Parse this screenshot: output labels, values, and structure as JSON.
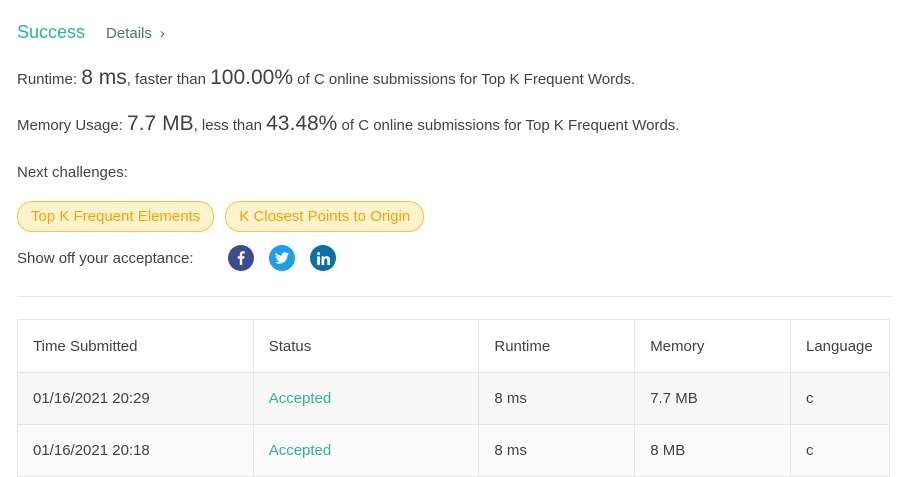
{
  "header": {
    "status": "Success",
    "details_label": "Details",
    "chevron": "›"
  },
  "runtime": {
    "label": "Runtime: ",
    "value": "8 ms",
    "mid": ", faster than ",
    "percent": "100.00%",
    "tail": " of C online submissions for Top K Frequent Words."
  },
  "memory": {
    "label": "Memory Usage: ",
    "value": "7.7 MB",
    "mid": ", less than ",
    "percent": "43.48%",
    "tail": " of C online submissions for Top K Frequent Words."
  },
  "next": {
    "label": "Next challenges:",
    "challenges": [
      "Top K Frequent Elements",
      "K Closest Points to Origin"
    ]
  },
  "share": {
    "label": "Show off your acceptance:",
    "icons": [
      "facebook-icon",
      "twitter-icon",
      "linkedin-icon"
    ]
  },
  "table": {
    "columns": [
      "Time Submitted",
      "Status",
      "Runtime",
      "Memory",
      "Language"
    ],
    "rows": [
      [
        "01/16/2021 20:29",
        "Accepted",
        "8 ms",
        "7.7 MB",
        "c"
      ],
      [
        "01/16/2021 20:18",
        "Accepted",
        "8 ms",
        "8 MB",
        "c"
      ]
    ]
  },
  "colors": {
    "success": "#2db495",
    "chip_bg": "#fff3cd",
    "chip_text": "#f0a500",
    "facebook": "#3b4d8f",
    "twitter": "#1d9fe9",
    "linkedin": "#0a70a8"
  }
}
